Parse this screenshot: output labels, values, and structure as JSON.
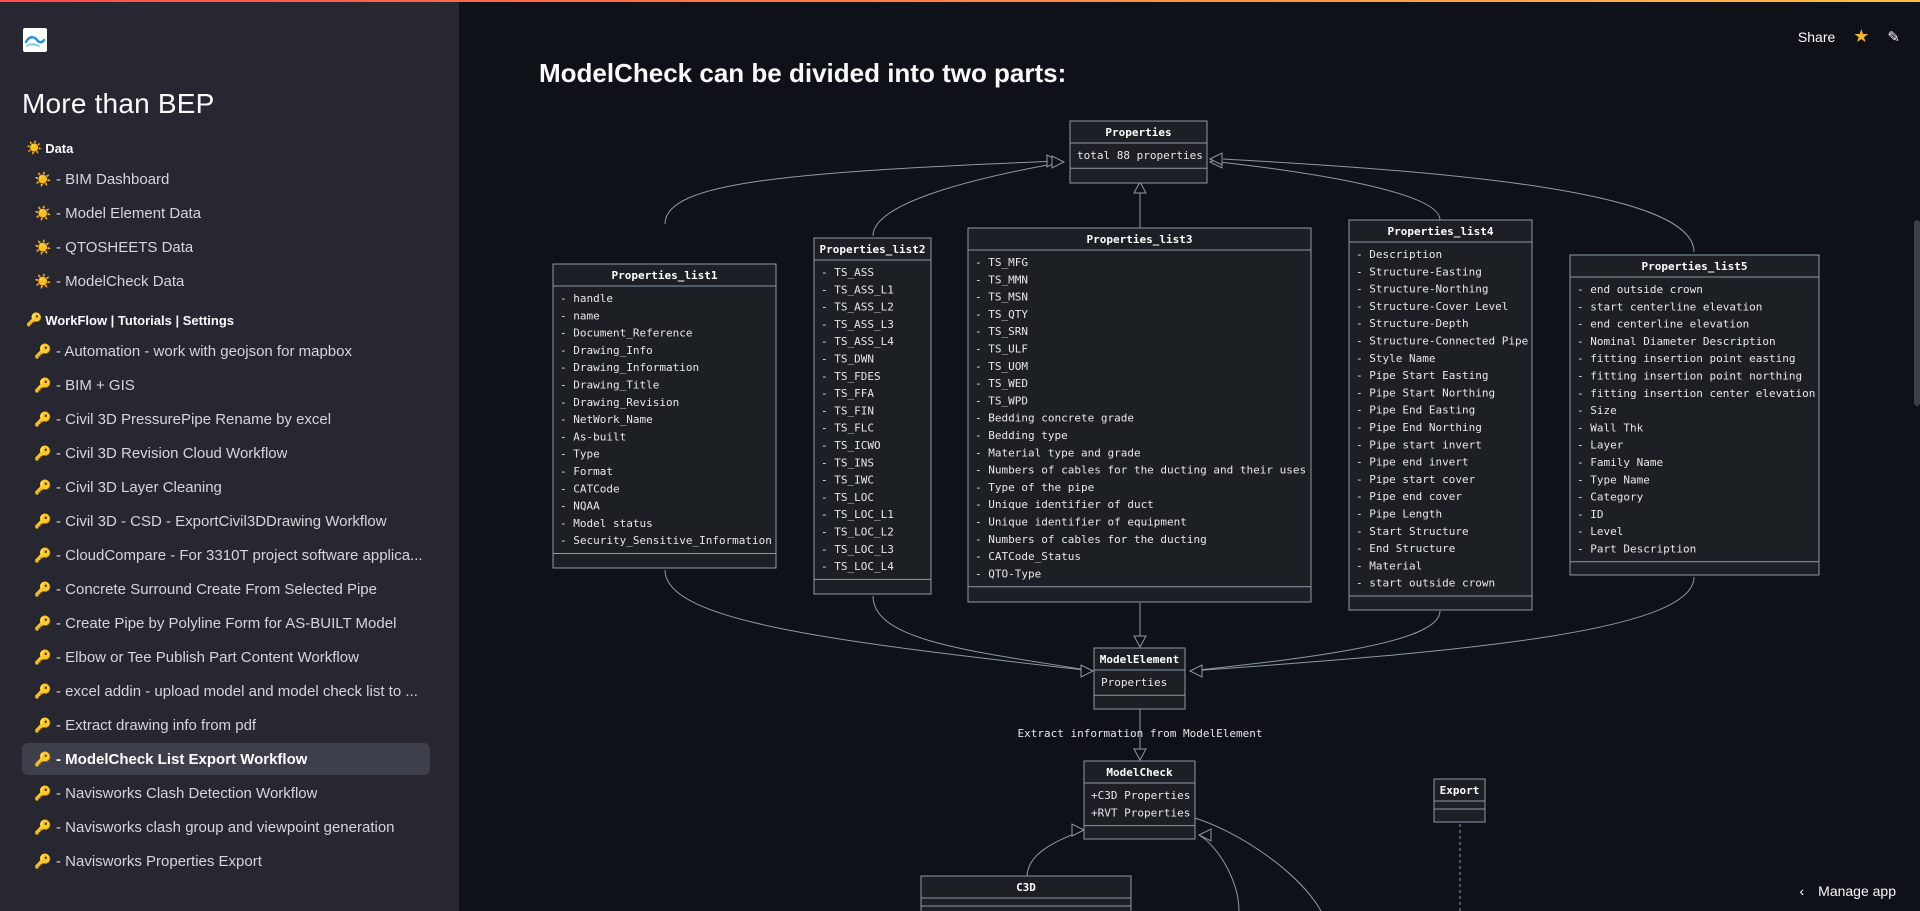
{
  "app": {
    "title": "More than BEP",
    "page_title": "ModelCheck can be divided into two parts:"
  },
  "colors": {
    "sidebar_bg": "#262730",
    "main_bg": "#0e1117",
    "active_item_bg": "#3d3f4b",
    "accent": "#ff4b4b",
    "star": "#f0b429"
  },
  "icons": {
    "logo": "app-logo-icon",
    "section_data": "sun-emoji-icon",
    "section_workflow": "key-emoji-icon"
  },
  "sidebar": {
    "sections": [
      {
        "header": "Data",
        "icon": "☀️",
        "items": [
          {
            "label": "- BIM Dashboard"
          },
          {
            "label": "- Model Element Data"
          },
          {
            "label": "- QTOSHEETS Data"
          },
          {
            "label": "- ModelCheck Data"
          }
        ]
      },
      {
        "header": "WorkFlow | Tutorials | Settings",
        "icon": "🔑",
        "items": [
          {
            "label": "- Automation - work with geojson for mapbox"
          },
          {
            "label": "- BIM + GIS"
          },
          {
            "label": "- Civil 3D PressurePipe Rename by excel"
          },
          {
            "label": "- Civil 3D Revision Cloud Workflow"
          },
          {
            "label": "- Civil 3D Layer Cleaning"
          },
          {
            "label": "- Civil 3D - CSD - ExportCivil3DDrawing Workflow"
          },
          {
            "label": "- CloudCompare - For 3310T project software applica..."
          },
          {
            "label": "- Concrete Surround Create From Selected Pipe"
          },
          {
            "label": "- Create Pipe by Polyline Form for AS-BUILT Model"
          },
          {
            "label": "- Elbow or Tee Publish Part Content Workflow"
          },
          {
            "label": "- excel addin - upload model and model check list to ..."
          },
          {
            "label": "- Extract drawing info from pdf"
          },
          {
            "label": "- ModelCheck List Export Workflow",
            "active": true
          },
          {
            "label": "- Navisworks Clash Detection Workflow"
          },
          {
            "label": "- Navisworks clash group and viewpoint generation"
          },
          {
            "label": "- Navisworks Properties Export"
          }
        ]
      }
    ]
  },
  "toolbar": {
    "share_label": "Share",
    "star_icon": "star-icon",
    "edit_icon": "pencil-icon"
  },
  "footer": {
    "manage_label": "Manage app",
    "manage_icon": "chevron-left-icon"
  },
  "diagram": {
    "properties": {
      "title": "Properties",
      "body": [
        "total 88 properties"
      ]
    },
    "lists": [
      {
        "title": "Properties_list1",
        "items": [
          "- handle",
          "- name",
          "- Document_Reference",
          "- Drawing_Info",
          "- Drawing_Information",
          "- Drawing_Title",
          "- Drawing_Revision",
          "- NetWork_Name",
          "- As-built",
          "- Type",
          "- Format",
          "- CATCode",
          "- NQAA",
          "- Model status",
          "- Security_Sensitive_Information"
        ]
      },
      {
        "title": "Properties_list2",
        "items": [
          "- TS_ASS",
          "- TS_ASS_L1",
          "- TS_ASS_L2",
          "- TS_ASS_L3",
          "- TS_ASS_L4",
          "- TS_DWN",
          "- TS_FDES",
          "- TS_FFA",
          "- TS_FIN",
          "- TS_FLC",
          "- TS_ICWO",
          "- TS_INS",
          "- TS_IWC",
          "- TS_LOC",
          "- TS_LOC_L1",
          "- TS_LOC_L2",
          "- TS_LOC_L3",
          "- TS_LOC_L4"
        ]
      },
      {
        "title": "Properties_list3",
        "items": [
          "- TS_MFG",
          "- TS_MMN",
          "- TS_MSN",
          "- TS_QTY",
          "- TS_SRN",
          "- TS_ULF",
          "- TS_UOM",
          "- TS_WED",
          "- TS_WPD",
          "- Bedding concrete grade",
          "- Bedding type",
          "- Material type and grade",
          "- Numbers of cables for the ducting and their uses",
          "- Type of the pipe",
          "- Unique identifier of duct",
          "- Unique identifier of equipment",
          "- Numbers of cables for the ducting",
          "- CATCode_Status",
          "- QTO-Type"
        ]
      },
      {
        "title": "Properties_list4",
        "items": [
          "- Description",
          "- Structure-Easting",
          "- Structure-Northing",
          "- Structure-Cover Level",
          "- Structure-Depth",
          "- Structure-Connected Pipe",
          "- Style Name",
          "- Pipe Start Easting",
          "- Pipe Start Northing",
          "- Pipe End Easting",
          "- Pipe End Northing",
          "- Pipe start invert",
          "- Pipe end invert",
          "- Pipe start cover",
          "- Pipe end cover",
          "- Pipe Length",
          "- Start Structure",
          "- End Structure",
          "- Material",
          "- start outside crown"
        ]
      },
      {
        "title": "Properties_list5",
        "items": [
          "- end outside crown",
          "- start centerline elevation",
          "- end centerline elevation",
          "- Nominal Diameter Description",
          "- fitting insertion point easting",
          "- fitting insertion point northing",
          "- fitting insertion center elevation",
          "- Size",
          "- Wall Thk",
          "- Layer",
          "- Family Name",
          "- Type Name",
          "- Category",
          "- ID",
          "- Level",
          "- Part Description"
        ]
      }
    ],
    "model_element": {
      "title": "ModelElement",
      "body": [
        "Properties"
      ]
    },
    "edge_label": "Extract information from ModelElement",
    "model_check": {
      "title": "ModelCheck",
      "body": [
        "+C3D Properties",
        "+RVT Properties"
      ]
    },
    "export": {
      "title": "Export"
    },
    "c3d": {
      "title": "C3D"
    }
  }
}
